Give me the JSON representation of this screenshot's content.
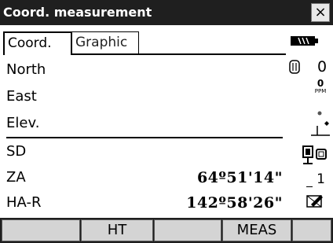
{
  "window": {
    "title": "Coord. measurement",
    "close_label": "×"
  },
  "tabs": [
    {
      "label": "Coord.",
      "active": true
    },
    {
      "label": "Graphic",
      "active": false
    }
  ],
  "coords": {
    "north_label": "North",
    "north_value": "",
    "east_label": "East",
    "east_value": "",
    "elev_label": "Elev.",
    "elev_value": ""
  },
  "measure": {
    "sd_label": "SD",
    "sd_value": "",
    "za_label": "ZA",
    "za_value": "64º51'14\"",
    "har_label": "HA-R",
    "har_value": "142º58'26\""
  },
  "status": {
    "battery_icon": "battery-icon",
    "prism_constant": "0",
    "ppm_value": "0",
    "ppm_unit": "PPM",
    "target_type": "1",
    "icons": [
      "battery-icon",
      "prism-icon",
      "ppm-icon",
      "tilt-icon",
      "laser-icon",
      "target-icon",
      "input-mode-icon"
    ]
  },
  "softkeys": [
    "",
    "HT",
    "",
    "MEAS",
    ""
  ]
}
